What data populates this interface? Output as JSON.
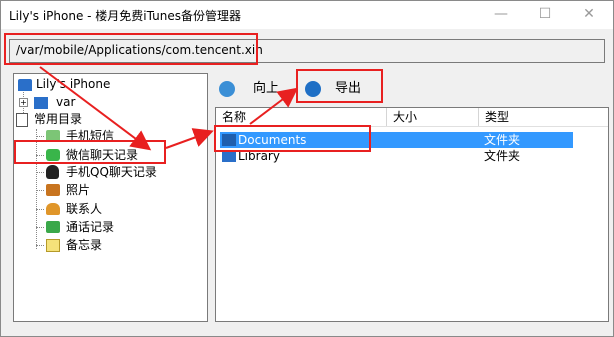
{
  "window": {
    "title": "Lily's iPhone - 楼月免费iTunes备份管理器",
    "min": "—",
    "max": "☐",
    "close": "✕"
  },
  "path": "/var/mobile/Applications/com.tencent.xin",
  "tree": {
    "root": "Lily's iPhone",
    "var": "var",
    "common": "常用目录",
    "items": [
      "手机短信",
      "微信聊天记录",
      "手机QQ聊天记录",
      "照片",
      "联系人",
      "通话记录",
      "备忘录"
    ]
  },
  "toolbar": {
    "up": "向上",
    "export": "导出"
  },
  "list": {
    "columns": [
      "名称",
      "大小",
      "类型"
    ],
    "rows": [
      {
        "name": "Documents",
        "size": "",
        "type": "文件夹"
      },
      {
        "name": "Library",
        "size": "",
        "type": "文件夹"
      }
    ]
  },
  "colors": {
    "selection": "#3399ff",
    "highlight": "#e82020"
  }
}
